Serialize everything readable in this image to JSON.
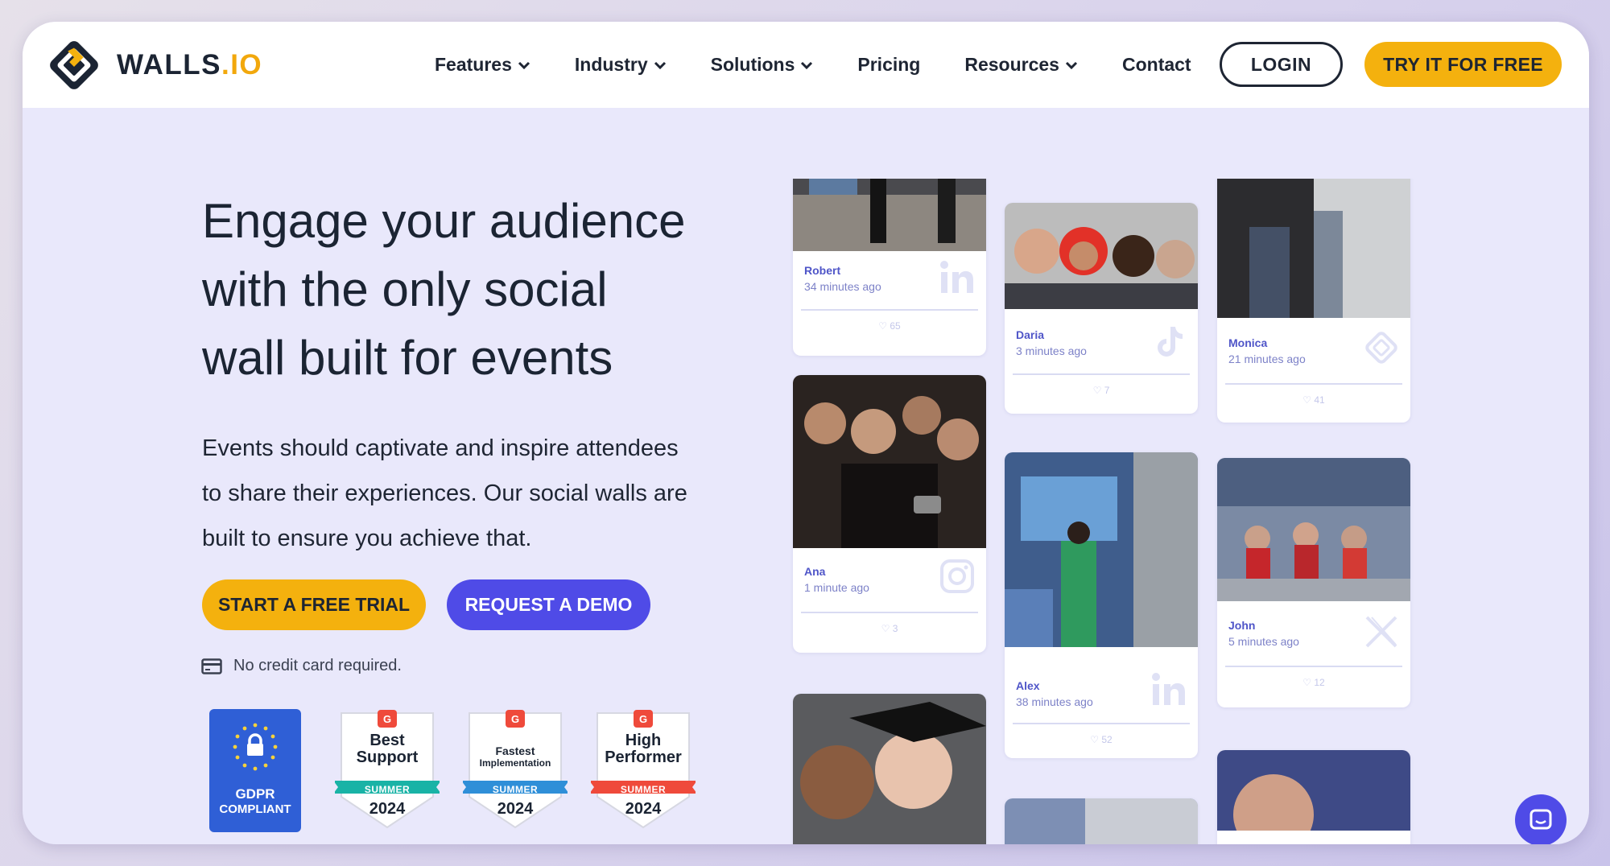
{
  "brand": {
    "name_main": "WALLS",
    "name_suffix": ".IO",
    "logo_icon": "walls-logo-icon"
  },
  "nav": {
    "items": [
      {
        "label": "Features",
        "dropdown": true
      },
      {
        "label": "Industry",
        "dropdown": true
      },
      {
        "label": "Solutions",
        "dropdown": true
      },
      {
        "label": "Pricing",
        "dropdown": false
      },
      {
        "label": "Resources",
        "dropdown": true
      },
      {
        "label": "Contact",
        "dropdown": false
      }
    ],
    "login_label": "LOGIN",
    "try_label": "TRY IT FOR FREE"
  },
  "hero": {
    "headline_lines": [
      "Engage your audience",
      "with the only social",
      "wall built for events"
    ],
    "sub_lines": [
      "Events should captivate and inspire attendees",
      "to share their experiences. Our social walls are",
      "built to ensure you achieve that."
    ],
    "cta_primary": "START A FREE TRIAL",
    "cta_secondary": "REQUEST A DEMO",
    "note": "No credit card required."
  },
  "badges": {
    "gdpr": {
      "line1": "GDPR",
      "line2": "COMPLIANT"
    },
    "g2": [
      {
        "title_lines": [
          "Best",
          "Support"
        ],
        "season": "SUMMER",
        "year": "2024",
        "ribbon": "#19b3a6"
      },
      {
        "title_lines": [
          "Fastest",
          "Implementation"
        ],
        "season": "SUMMER",
        "year": "2024",
        "ribbon": "#2f8fd8"
      },
      {
        "title_lines": [
          "High",
          "Performer"
        ],
        "season": "SUMMER",
        "year": "2024",
        "ribbon": "#ef4a3b"
      }
    ]
  },
  "wall": {
    "cards": [
      {
        "name": "Robert",
        "time": "34 minutes ago",
        "likes": "65",
        "network": "linkedin-icon"
      },
      {
        "name": "Daria",
        "time": "3 minutes ago",
        "likes": "7",
        "network": "tiktok-icon"
      },
      {
        "name": "Monica",
        "time": "21 minutes ago",
        "likes": "41",
        "network": "walls-icon"
      },
      {
        "name": "Ana",
        "time": "1 minute ago",
        "likes": "3",
        "network": "instagram-icon"
      },
      {
        "name": "Alex",
        "time": "38 minutes ago",
        "likes": "52",
        "network": "linkedin-icon"
      },
      {
        "name": "John",
        "time": "5 minutes ago",
        "likes": "12",
        "network": "x-icon"
      }
    ]
  },
  "colors": {
    "accent_yellow": "#f4b10e",
    "accent_blue": "#4f4be7",
    "bg_lavender": "#e9e8fb",
    "ink": "#1b2433"
  }
}
